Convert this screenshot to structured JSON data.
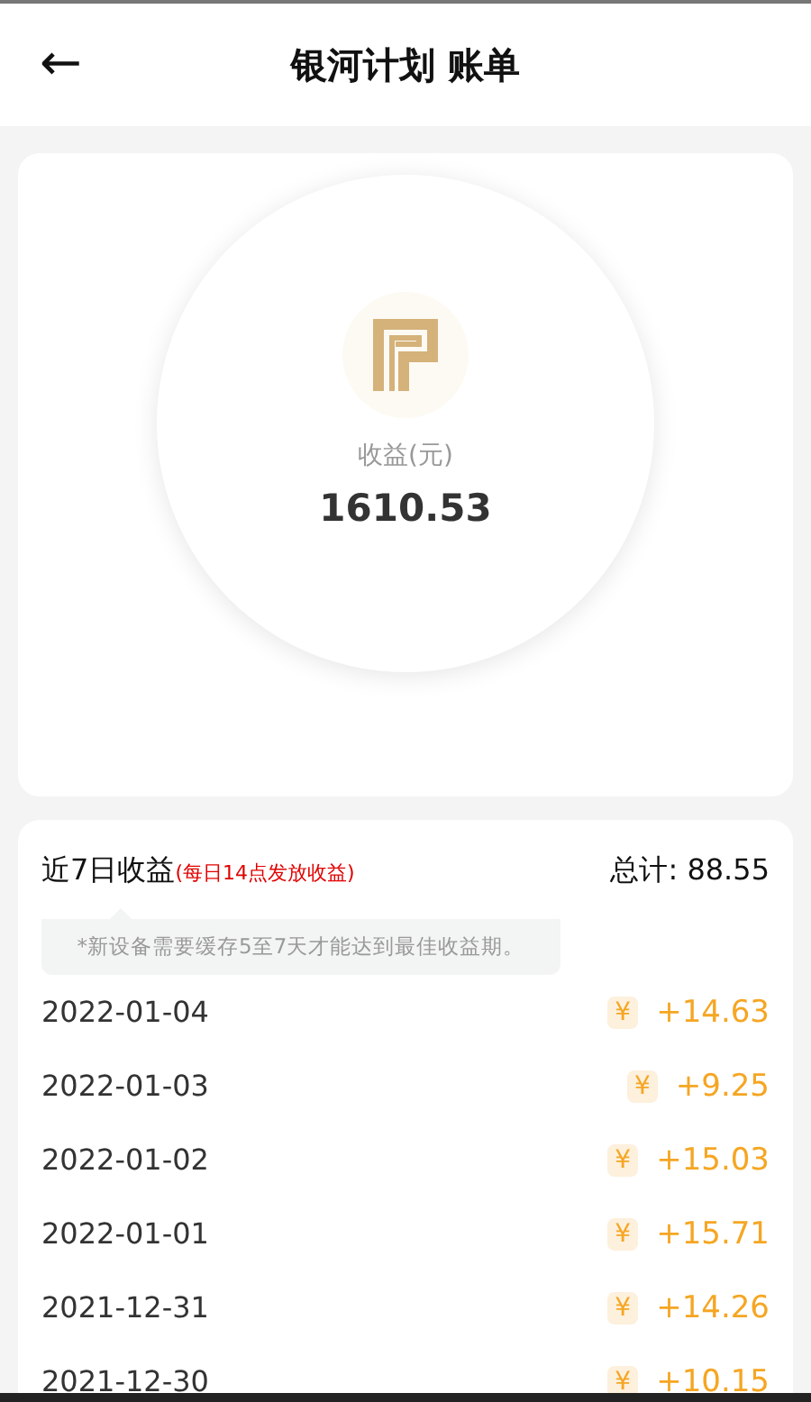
{
  "header": {
    "back": "←",
    "title": "银河计划 账单"
  },
  "earnings": {
    "label": "收益(元)",
    "amount": "1610.53"
  },
  "recent": {
    "title": "近7日收益",
    "note": "(每日14点发放收益)",
    "total": "总计: 88.55",
    "tip": "*新设备需要缓存5至7天才能达到最佳收益期。",
    "rows": [
      {
        "date": "2022-01-04",
        "currency": "¥",
        "amount": "+14.63"
      },
      {
        "date": "2022-01-03",
        "currency": "¥",
        "amount": "+9.25"
      },
      {
        "date": "2022-01-02",
        "currency": "¥",
        "amount": "+15.03"
      },
      {
        "date": "2022-01-01",
        "currency": "¥",
        "amount": "+15.71"
      },
      {
        "date": "2021-12-31",
        "currency": "¥",
        "amount": "+14.26"
      },
      {
        "date": "2021-12-30",
        "currency": "¥",
        "amount": "+10.15"
      }
    ]
  }
}
